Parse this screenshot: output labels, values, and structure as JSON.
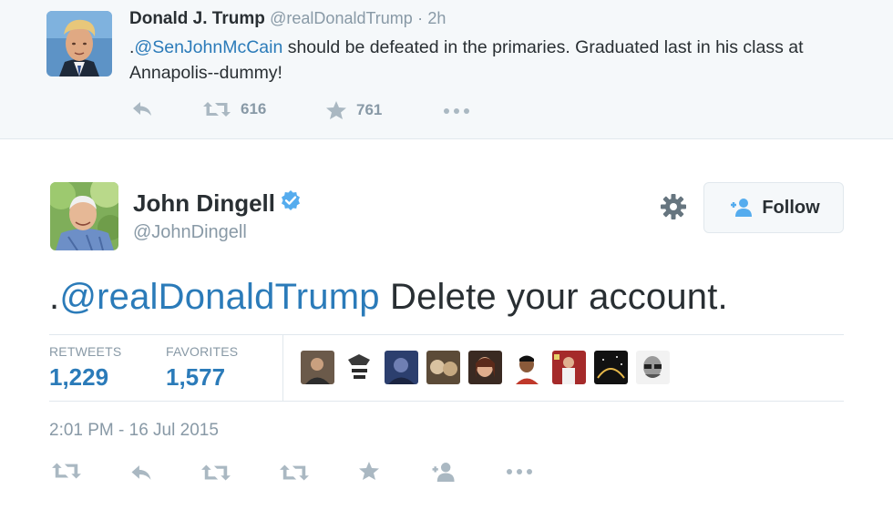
{
  "parent_tweet": {
    "author_name": "Donald J. Trump",
    "author_handle": "@realDonaldTrump",
    "separator": "·",
    "time_ago": "2h",
    "text_prefix": ".",
    "mention": "@SenJohnMcCain",
    "text_rest": " should be defeated in the primaries. Graduated last in his class at Annapolis--dummy!",
    "retweet_count": "616",
    "favorite_count": "761"
  },
  "main_tweet": {
    "author_name": "John Dingell",
    "author_handle": "@JohnDingell",
    "follow_label": "Follow",
    "text_prefix": ".",
    "mention": "@realDonaldTrump",
    "text_rest": " Delete your account.",
    "stats": {
      "retweets_label": "RETWEETS",
      "retweets_value": "1,229",
      "favorites_label": "FAVORITES",
      "favorites_value": "1,577"
    },
    "timestamp": "2:01 PM - 16 Jul 2015"
  },
  "colors": {
    "link": "#2b7bb9",
    "muted": "#8899a6",
    "icon": "#aab8c2",
    "verified": "#55acee",
    "background_context": "#f5f8fa"
  },
  "icons": [
    "reply-icon",
    "retweet-icon",
    "favorite-star-icon",
    "more-dots-icon",
    "gear-icon",
    "follow-person-icon",
    "verified-badge-icon"
  ]
}
